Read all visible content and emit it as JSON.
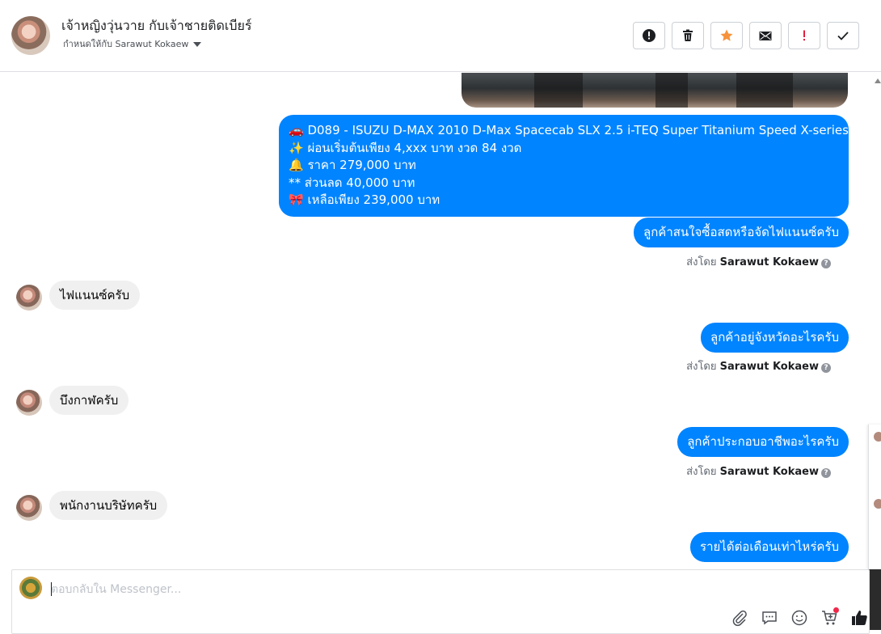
{
  "header": {
    "title": "เจ้าหญิงวุ่นวาย กับเจ้าชายติดเบียร์",
    "assigned_to": "กำหนดให้กับ Sarawut Kokaew",
    "actions": [
      {
        "name": "report-button",
        "icon": "exclamation-circle-icon"
      },
      {
        "name": "delete-button",
        "icon": "trash-icon"
      },
      {
        "name": "star-button",
        "icon": "star-icon",
        "color": "#f7923b"
      },
      {
        "name": "mark-unread-button",
        "icon": "envelope-icon"
      },
      {
        "name": "important-button",
        "icon": "exclamation-icon",
        "color": "#e41e3f"
      },
      {
        "name": "done-button",
        "icon": "checkmark-icon"
      }
    ]
  },
  "messages": {
    "car_info": {
      "line1": "🚗 D089 - ISUZU D-MAX 2010 D-Max Spacecab SLX 2.5 i-TEQ Super Titanium Speed X-series MT",
      "line2": "✨ ผ่อนเริ่มต้นเพียง 4,xxx บาท งวด 84 งวด",
      "line3": "🔔  ราคา 279,000 บาท",
      "line4": "** ส่วนลด 40,000 บาท",
      "line5": "🎀 เหลือเพียง 239,000 บาท"
    },
    "out_1": "ลูกค้าสนใจซื้อสดหรือจัดไฟแนนซ์ครับ",
    "in_1": "ไฟแนนซ์ครับ",
    "out_2": "ลูกค้าอยู่จังหวัดอะไรครับ",
    "in_2": "บึงกาฬครับ",
    "out_3": "ลูกค้าประกอบอาชีพอะไรครับ",
    "in_3": "พนักงานบริษัทครับ",
    "out_4": "รายได้ต่อเดือนเท่าไหร่ครับ",
    "sent_by_prefix": "ส่งโดย",
    "sent_by_name": "Sarawut Kokaew"
  },
  "composer": {
    "placeholder": "ตอบกลับใน Messenger...",
    "tools": [
      "paperclip-icon",
      "saved-reply-icon",
      "emoji-icon",
      "cart-icon",
      "thumbs-up-icon"
    ]
  },
  "colors": {
    "outgoing_bubble": "#0084ff",
    "incoming_bubble": "#f1f0f0",
    "star": "#f7923b",
    "important": "#e41e3f"
  }
}
